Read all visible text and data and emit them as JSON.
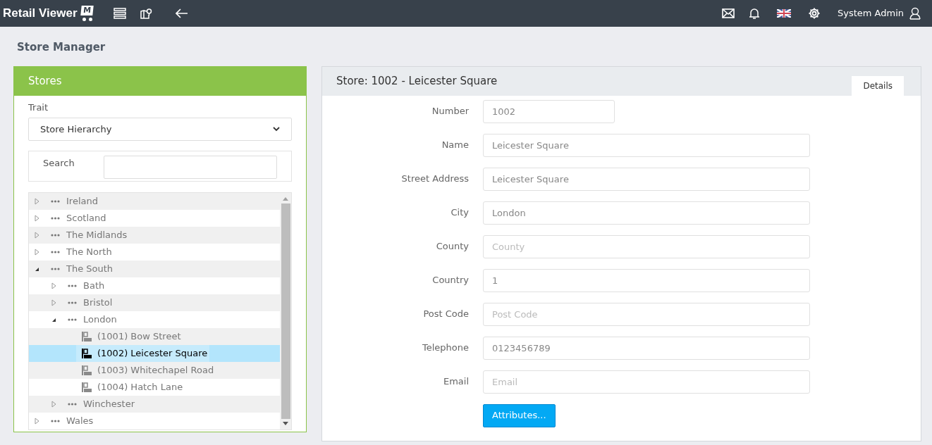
{
  "header": {
    "logo": {
      "text": "Retail Viewer",
      "badge": "M"
    },
    "user": "System Admin"
  },
  "page_title": "Store Manager",
  "stores_panel": {
    "title": "Stores",
    "trait_label": "Trait",
    "trait_value": "Store Hierarchy",
    "search_label": "Search",
    "tree": [
      {
        "kind": "group",
        "label": "Ireland",
        "expanded": false,
        "selected": false
      },
      {
        "kind": "group",
        "label": "Scotland",
        "expanded": false,
        "selected": false
      },
      {
        "kind": "group",
        "label": "The Midlands",
        "expanded": false,
        "selected": false
      },
      {
        "kind": "group",
        "label": "The North",
        "expanded": false,
        "selected": false
      },
      {
        "kind": "group",
        "label": "The South",
        "expanded": true,
        "selected": false,
        "children": [
          {
            "kind": "group",
            "label": "Bath",
            "expanded": false,
            "selected": false
          },
          {
            "kind": "group",
            "label": "Bristol",
            "expanded": false,
            "selected": false
          },
          {
            "kind": "group",
            "label": "London",
            "expanded": true,
            "selected": false,
            "children": [
              {
                "kind": "store",
                "label": "(1001) Bow Street",
                "selected": false
              },
              {
                "kind": "store",
                "label": "(1002) Leicester Square",
                "selected": true
              },
              {
                "kind": "store",
                "label": "(1003) Whitechapel Road",
                "selected": false
              },
              {
                "kind": "store",
                "label": "(1004) Hatch Lane",
                "selected": false
              }
            ]
          },
          {
            "kind": "group",
            "label": "Winchester",
            "expanded": false,
            "selected": false
          }
        ]
      },
      {
        "kind": "group",
        "label": "Wales",
        "expanded": false,
        "selected": false
      }
    ]
  },
  "details_panel": {
    "title": "Store: 1002 - Leicester Square",
    "tab": "Details",
    "fields": [
      {
        "label": "Number",
        "value": "1002",
        "narrow": true
      },
      {
        "label": "Name",
        "value": "Leicester Square"
      },
      {
        "label": "Street Address",
        "value": "Leicester Square"
      },
      {
        "label": "City",
        "value": "London"
      },
      {
        "label": "County",
        "placeholder": "County"
      },
      {
        "label": "Country",
        "value": "1"
      },
      {
        "label": "Post Code",
        "placeholder": "Post Code"
      },
      {
        "label": "Telephone",
        "value": "0123456789"
      },
      {
        "label": "Email",
        "placeholder": "Email"
      }
    ],
    "button": "Attributes..."
  }
}
